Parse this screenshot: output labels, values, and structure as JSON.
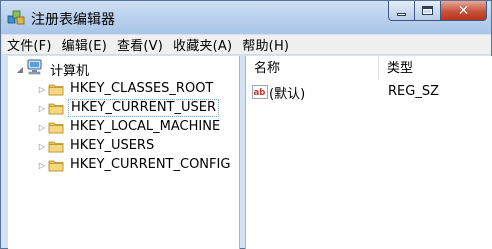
{
  "window": {
    "title": "注册表编辑器"
  },
  "menu": [
    {
      "label": "文件(F)"
    },
    {
      "label": "编辑(E)"
    },
    {
      "label": "查看(V)"
    },
    {
      "label": "收藏夹(A)"
    },
    {
      "label": "帮助(H)"
    }
  ],
  "tree": {
    "root": "计算机",
    "keys": [
      {
        "label": "HKEY_CLASSES_ROOT"
      },
      {
        "label": "HKEY_CURRENT_USER"
      },
      {
        "label": "HKEY_LOCAL_MACHINE"
      },
      {
        "label": "HKEY_USERS"
      },
      {
        "label": "HKEY_CURRENT_CONFIG"
      }
    ],
    "selected_key": "HKEY_CURRENT_USER"
  },
  "list": {
    "columns": {
      "name": "名称",
      "type": "类型"
    },
    "rows": [
      {
        "name": "(默认)",
        "type": "REG_SZ"
      }
    ]
  },
  "icons": {
    "app": "registry-editor-icon",
    "root": "computer-icon",
    "key": "folder-icon",
    "value": "string-value-icon"
  }
}
